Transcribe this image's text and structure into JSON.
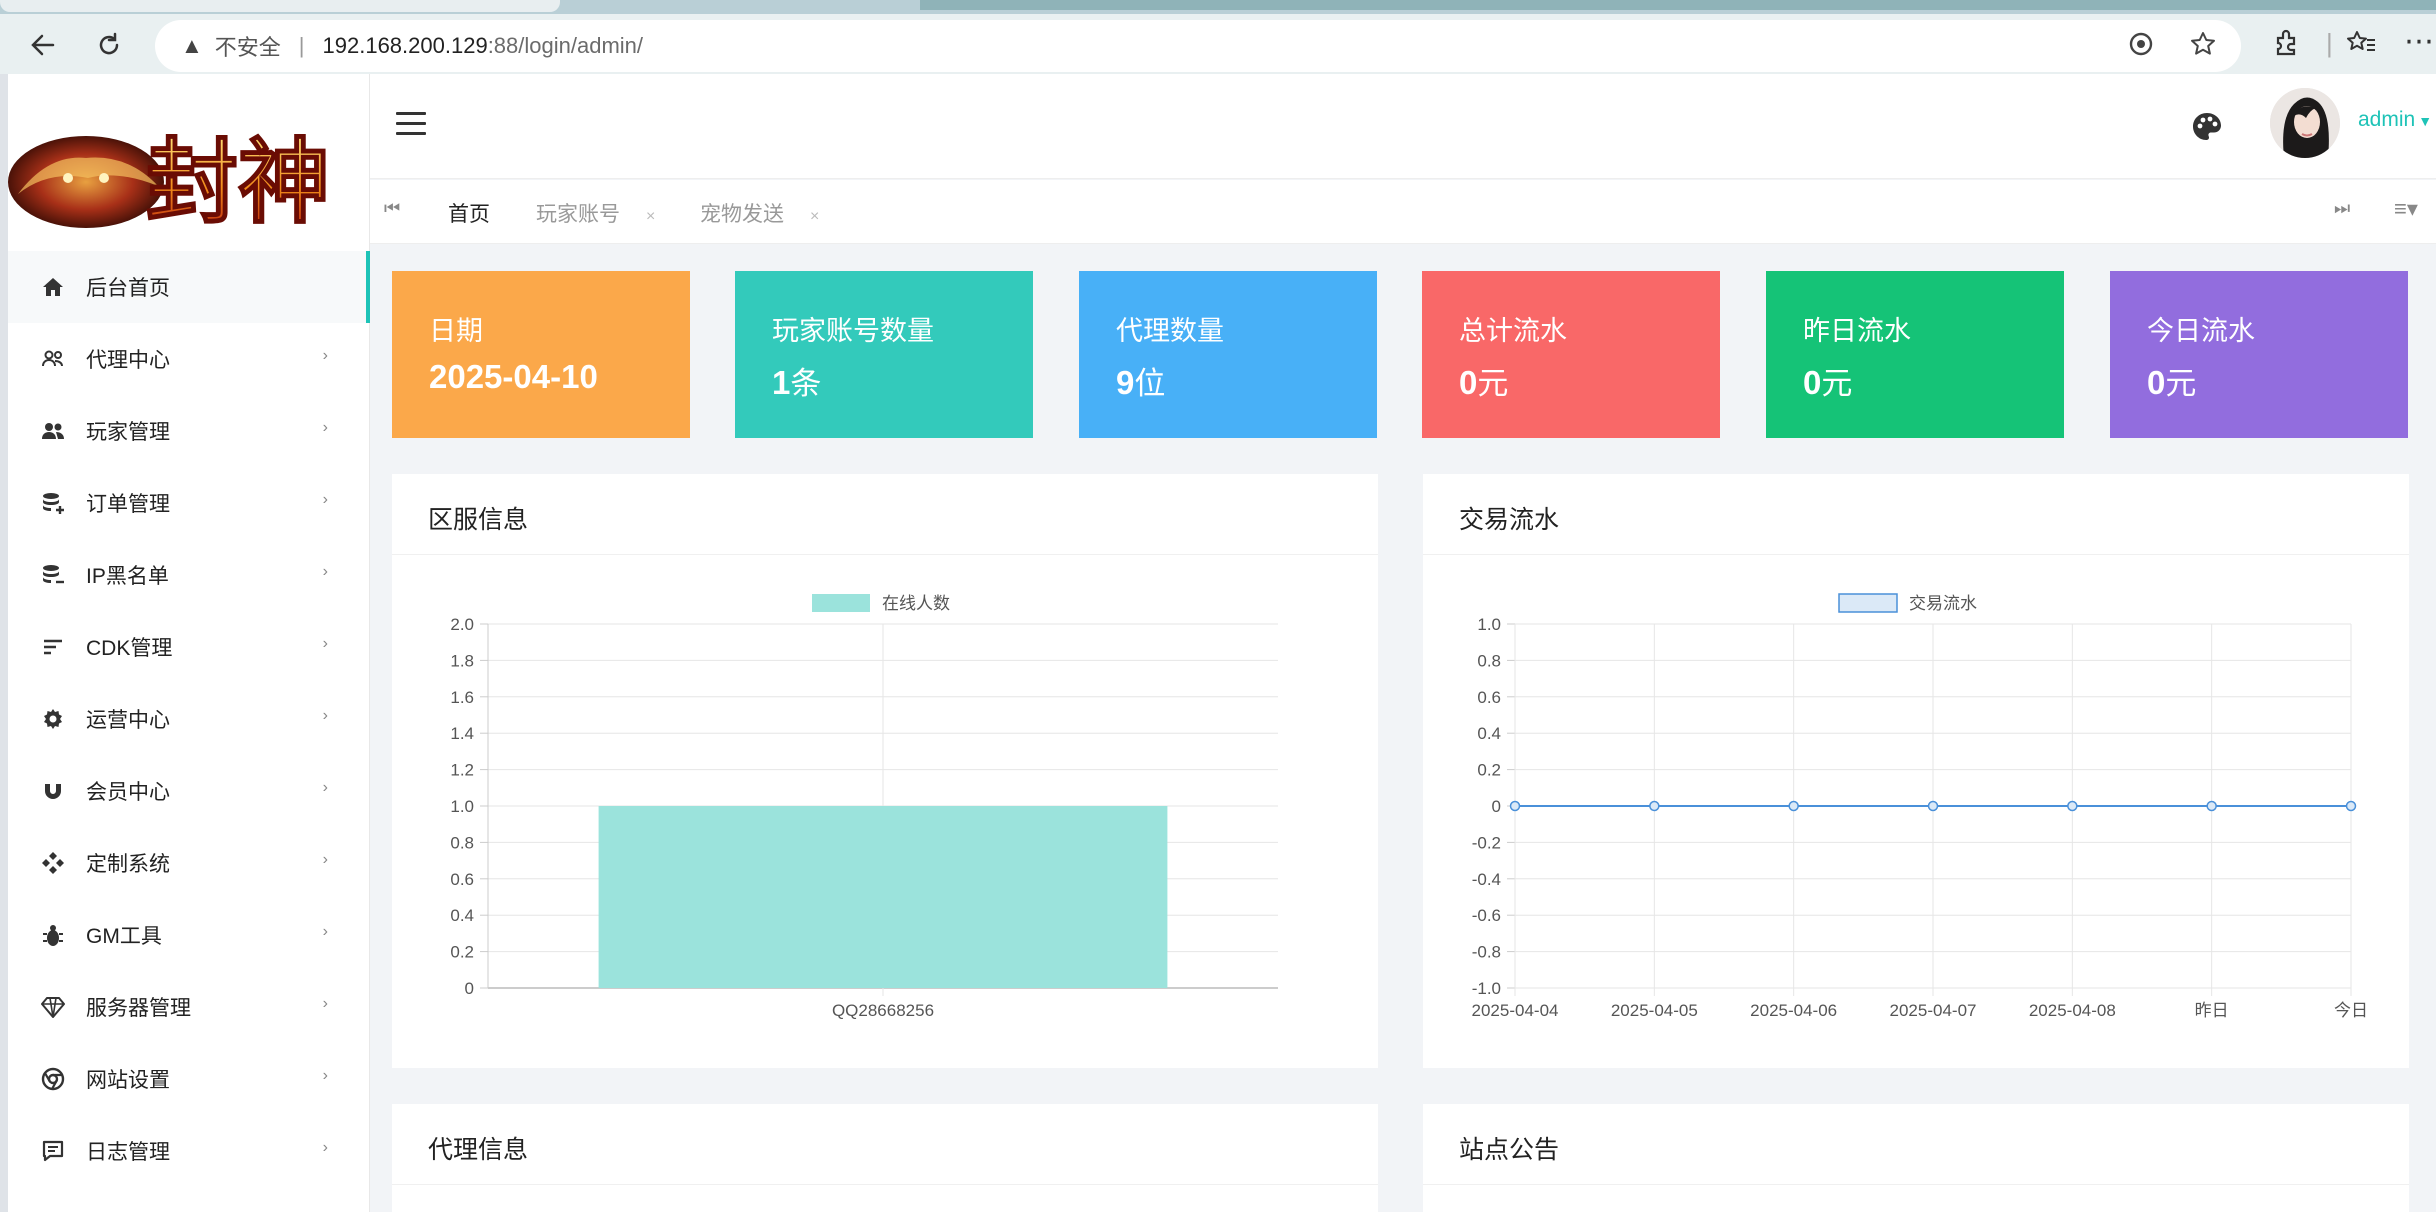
{
  "browser": {
    "security_label": "不安全",
    "url_host": "192.168.200.129",
    "url_rest": ":88/login/admin/"
  },
  "sidebar": {
    "items": [
      {
        "label": "后台首页",
        "icon": "home-icon",
        "active": true
      },
      {
        "label": "代理中心",
        "icon": "users-outline-icon"
      },
      {
        "label": "玩家管理",
        "icon": "users-icon"
      },
      {
        "label": "订单管理",
        "icon": "database-plus-icon"
      },
      {
        "label": "IP黑名单",
        "icon": "database-minus-icon"
      },
      {
        "label": "CDK管理",
        "icon": "sort-lines-icon"
      },
      {
        "label": "运营中心",
        "icon": "gear-icon"
      },
      {
        "label": "会员中心",
        "icon": "magnet-icon"
      },
      {
        "label": "定制系统",
        "icon": "diamonds-icon"
      },
      {
        "label": "GM工具",
        "icon": "bug-icon"
      },
      {
        "label": "服务器管理",
        "icon": "gem-icon"
      },
      {
        "label": "网站设置",
        "icon": "chrome-icon"
      },
      {
        "label": "日志管理",
        "icon": "message-square-icon"
      }
    ]
  },
  "header": {
    "user": "admin"
  },
  "tabs": [
    {
      "label": "首页"
    },
    {
      "label": "玩家账号",
      "close": "×"
    },
    {
      "label": "宠物发送",
      "close": "×"
    }
  ],
  "stats": [
    {
      "label": "日期",
      "value": "2025-04-10",
      "unit": "",
      "color": "#fba84a"
    },
    {
      "label": "玩家账号数量",
      "value": "1",
      "unit": "条",
      "color": "#33cabb"
    },
    {
      "label": "代理数量",
      "value": "9",
      "unit": "位",
      "color": "#48b0f7"
    },
    {
      "label": "总计流水",
      "value": "0",
      "unit": "元",
      "color": "#f96868"
    },
    {
      "label": "昨日流水",
      "value": "0",
      "unit": "元",
      "color": "#15c377"
    },
    {
      "label": "今日流水",
      "value": "0",
      "unit": "元",
      "color": "#926dde"
    }
  ],
  "panels": {
    "server_info": "区服信息",
    "transactions": "交易流水",
    "agent_info": "代理信息",
    "announcement": "站点公告"
  },
  "chart_data": [
    {
      "type": "bar",
      "legend": [
        "在线人数"
      ],
      "categories": [
        "QQ28668256"
      ],
      "series": [
        {
          "name": "在线人数",
          "values": [
            1
          ]
        }
      ],
      "ylim": [
        0,
        2.0
      ],
      "yticks": [
        "2.0",
        "1.8",
        "1.6",
        "1.4",
        "1.2",
        "1.0",
        "0.8",
        "0.6",
        "0.4",
        "0.2",
        "0"
      ],
      "color": "#9be3dc",
      "grid": true
    },
    {
      "type": "line",
      "legend": [
        "交易流水"
      ],
      "x": [
        "2025-04-04",
        "2025-04-05",
        "2025-04-06",
        "2025-04-07",
        "2025-04-08",
        "昨日",
        "今日"
      ],
      "series": [
        {
          "name": "交易流水",
          "values": [
            0,
            0,
            0,
            0,
            0,
            0,
            0
          ]
        }
      ],
      "ylim": [
        -1.0,
        1.0
      ],
      "yticks": [
        "1.0",
        "0.8",
        "0.6",
        "0.4",
        "0.2",
        "0",
        "-0.2",
        "-0.4",
        "-0.6",
        "-0.8",
        "-1.0"
      ],
      "color": "#4a90d9",
      "grid": true
    }
  ]
}
